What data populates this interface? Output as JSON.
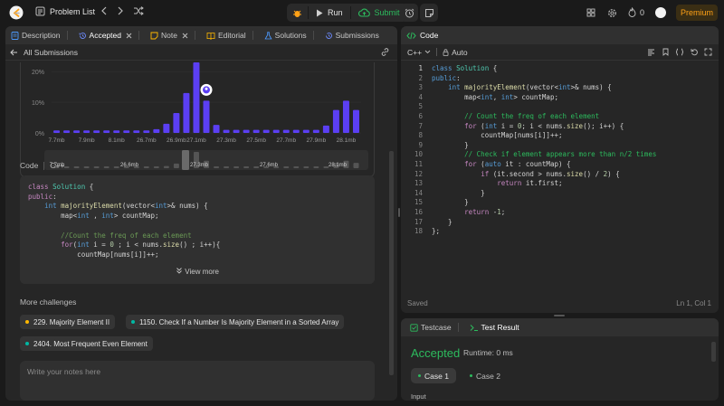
{
  "topbar": {
    "problem_list": "Problem List",
    "run": "Run",
    "submit": "Submit",
    "streak": "0",
    "premium": "Premium"
  },
  "left_tabs": [
    {
      "label": "Description"
    },
    {
      "label": "Accepted"
    },
    {
      "label": "Note"
    },
    {
      "label": "Editorial"
    },
    {
      "label": "Solutions"
    },
    {
      "label": "Submissions"
    }
  ],
  "all_submissions": "All Submissions",
  "chart_data": {
    "type": "bar",
    "y_ticks": [
      "20%",
      "10%",
      "0%"
    ],
    "ylim": [
      0,
      23
    ],
    "categories": [
      "7.7mb",
      "7.9mb",
      "8.1mb",
      "26.7mb",
      "26.9mb",
      "27.1mb",
      "27.3mb",
      "27.5mb",
      "27.7mb",
      "27.9mb",
      "28.1mb"
    ],
    "bar_values": [
      0.8,
      0.8,
      0.8,
      0.8,
      0.8,
      0.8,
      0.8,
      0.8,
      0.8,
      0.8,
      1.2,
      3,
      6.5,
      13,
      23,
      10.5,
      2.6,
      1,
      1,
      1,
      1,
      1,
      1,
      1,
      1,
      1,
      1,
      2.4,
      7.5,
      10.5,
      7.5
    ],
    "highlight_index": 15,
    "series_color": "#5b3ff3",
    "minimap_labels": [
      "7.7mb",
      "26.6mb",
      "27.3mb",
      "27.6mb",
      "28.1mb"
    ]
  },
  "code_section": {
    "label": "Code",
    "lang": "C++",
    "view_more": "View more"
  },
  "more_challenges": {
    "title": "More challenges",
    "items": [
      {
        "label": "229. Majority Element II",
        "color": "#ffb800"
      },
      {
        "label": "1150. Check If a Number Is Majority Element in a Sorted Array",
        "color": "#00b8a3"
      },
      {
        "label": "2404. Most Frequent Even Element",
        "color": "#00b8a3"
      }
    ]
  },
  "notes_placeholder": "Write your notes here",
  "code_panel": {
    "title": "Code",
    "lang": "C++",
    "mode": "Auto",
    "status": "Saved",
    "cursor": "Ln 1, Col 1"
  },
  "test_panel": {
    "tab_testcase": "Testcase",
    "tab_result": "Test Result",
    "status": "Accepted",
    "runtime": "Runtime: 0 ms",
    "case1": "Case 1",
    "case2": "Case 2",
    "input_label": "Input"
  },
  "colors": {
    "accent_green": "#2cbb5d",
    "premium": "#ffa116",
    "bar": "#5b3ff3"
  }
}
